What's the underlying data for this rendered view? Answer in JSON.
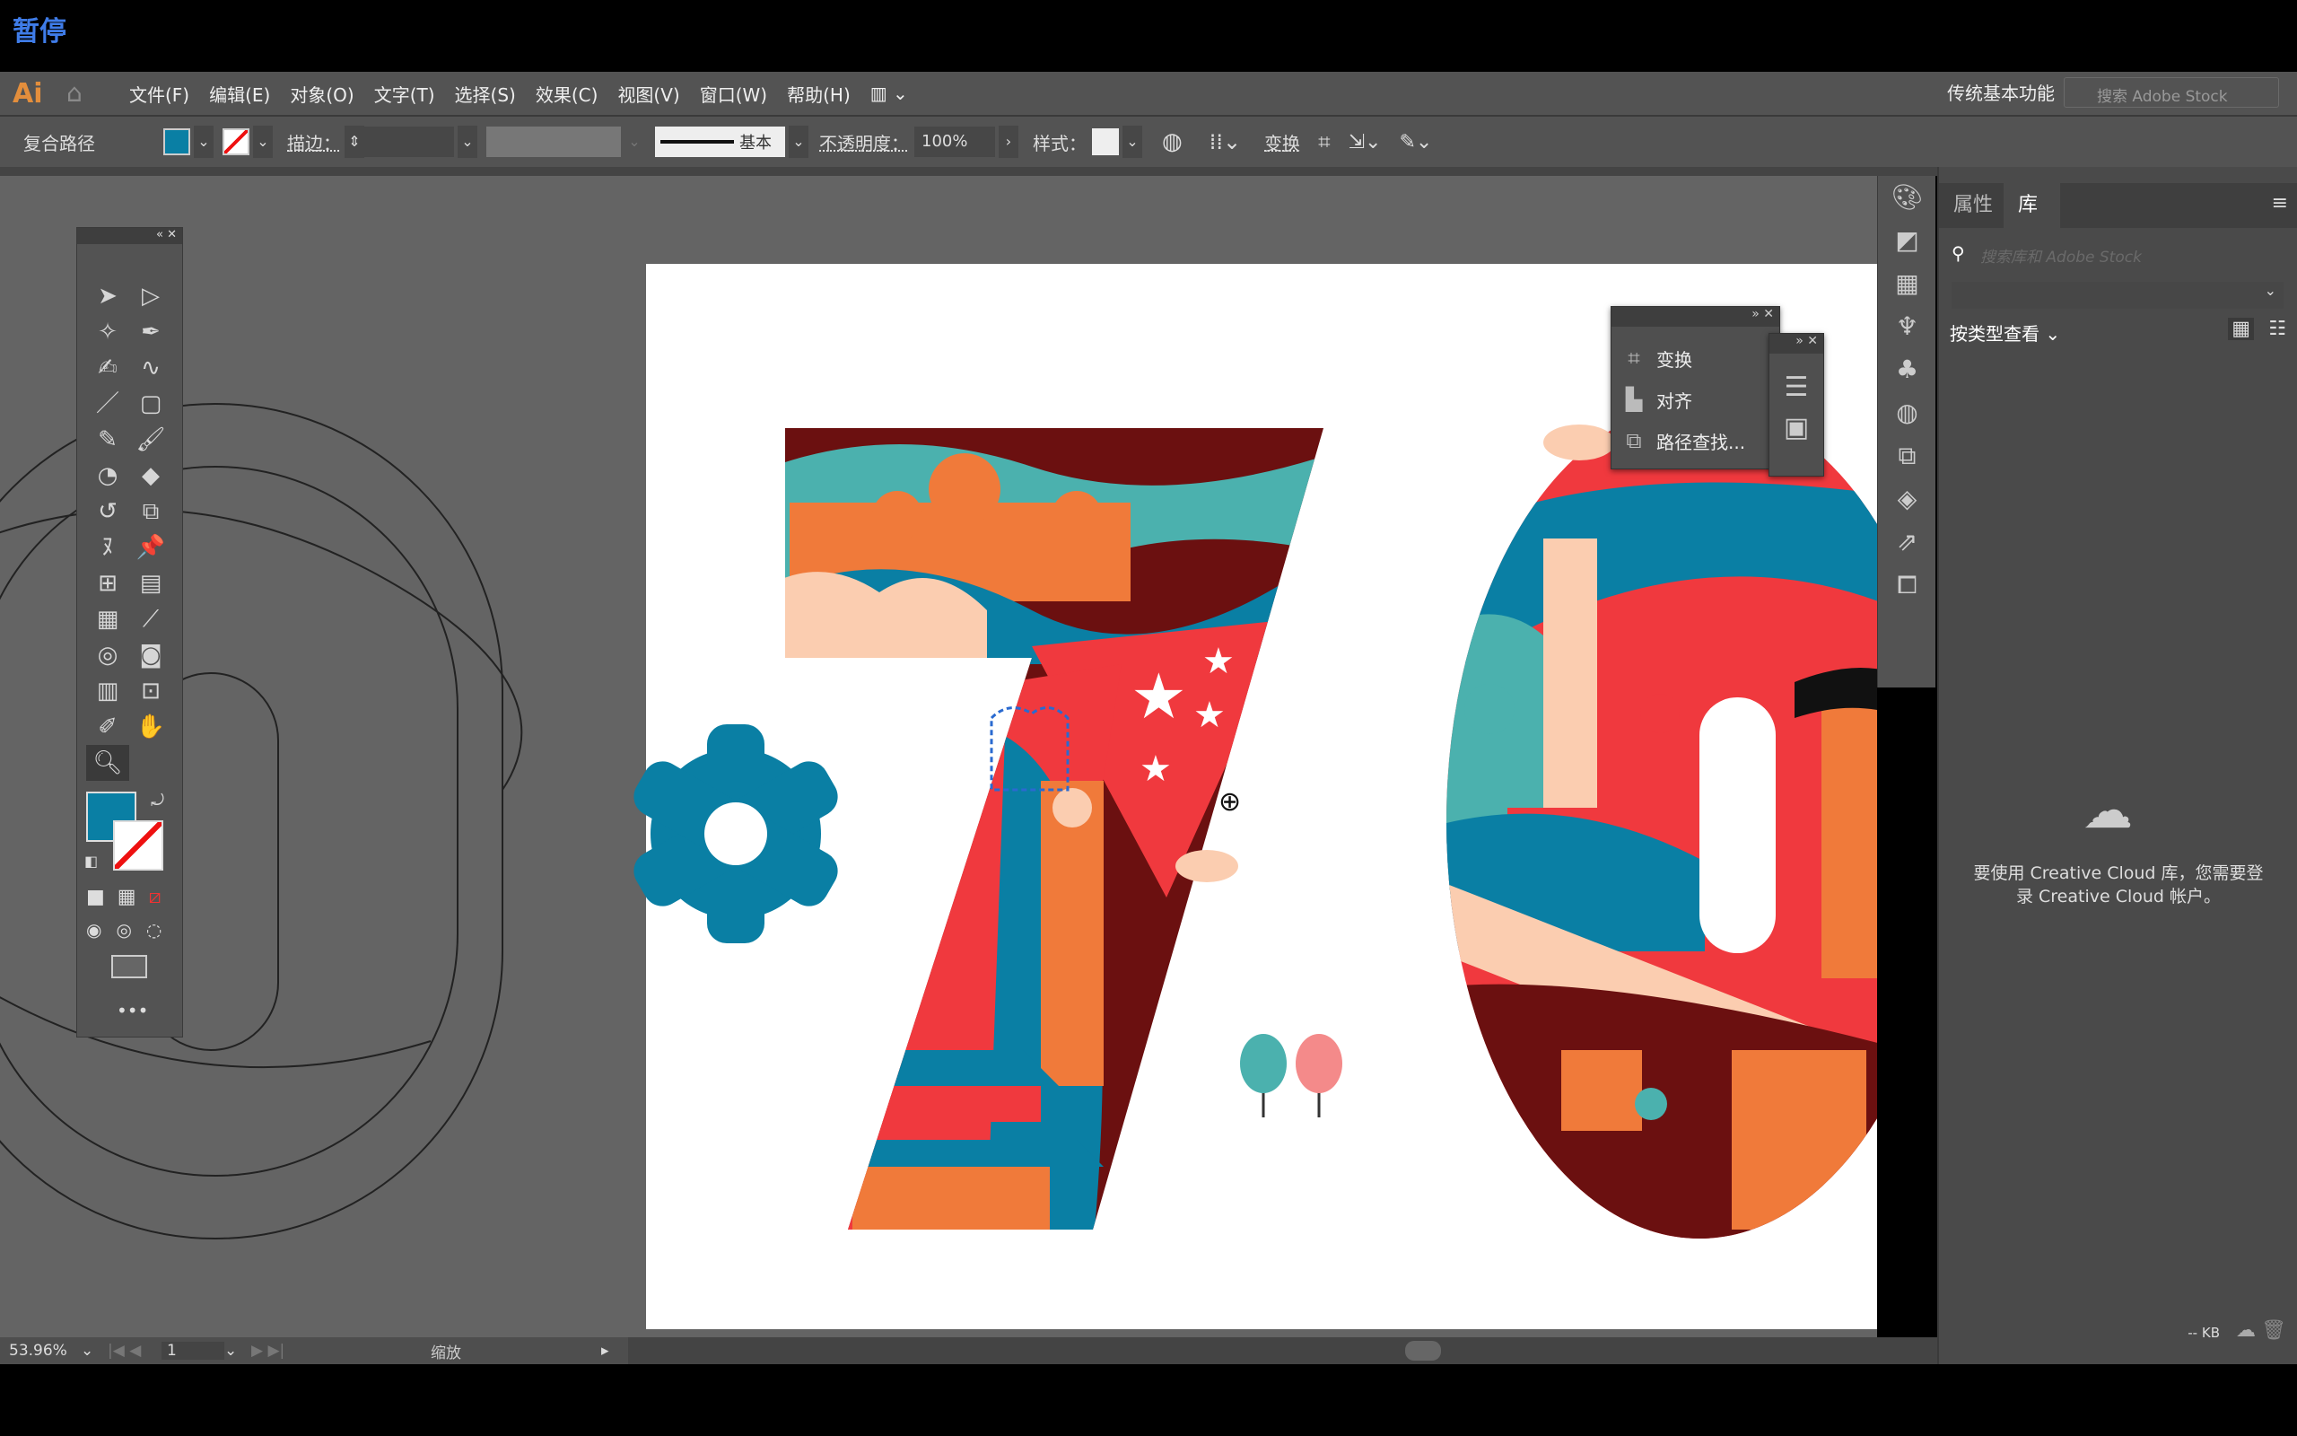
{
  "overlay": {
    "pause": "暂停"
  },
  "menubar": {
    "logo": "Ai",
    "items": [
      "文件(F)",
      "编辑(E)",
      "对象(O)",
      "文字(T)",
      "选择(S)",
      "效果(C)",
      "视图(V)",
      "窗口(W)",
      "帮助(H)"
    ],
    "workspace": "传统基本功能",
    "search_placeholder": "搜索 Adobe Stock"
  },
  "control": {
    "object_type": "复合路径",
    "fill_color": "#0a7fa4",
    "stroke_label": "描边：",
    "brush_label": "基本",
    "opacity_label": "不透明度：",
    "opacity_value": "100%",
    "style_label": "样式：",
    "transform": "变换"
  },
  "float_panel": {
    "items": [
      {
        "icon": "transform-icon",
        "label": "变换"
      },
      {
        "icon": "align-icon",
        "label": "对齐"
      },
      {
        "icon": "pathfinder-icon",
        "label": "路径查找..."
      }
    ]
  },
  "right_panel": {
    "tabs": [
      "属性",
      "库"
    ],
    "active_tab": "库",
    "search_placeholder": "搜索库和 Adobe Stock",
    "view_by": "按类型查看",
    "message": "要使用 Creative Cloud 库，您需要登录 Creative Cloud 帐户。",
    "size": "-- KB"
  },
  "status": {
    "zoom": "53.96%",
    "page": "1",
    "tool": "缩放"
  },
  "colors": {
    "teal": "#0a7fa4",
    "red": "#f0393e",
    "darkred": "#6b1010",
    "peach": "#fbcdb0",
    "orange": "#f07a3a",
    "aqua": "#4bb1ae"
  }
}
